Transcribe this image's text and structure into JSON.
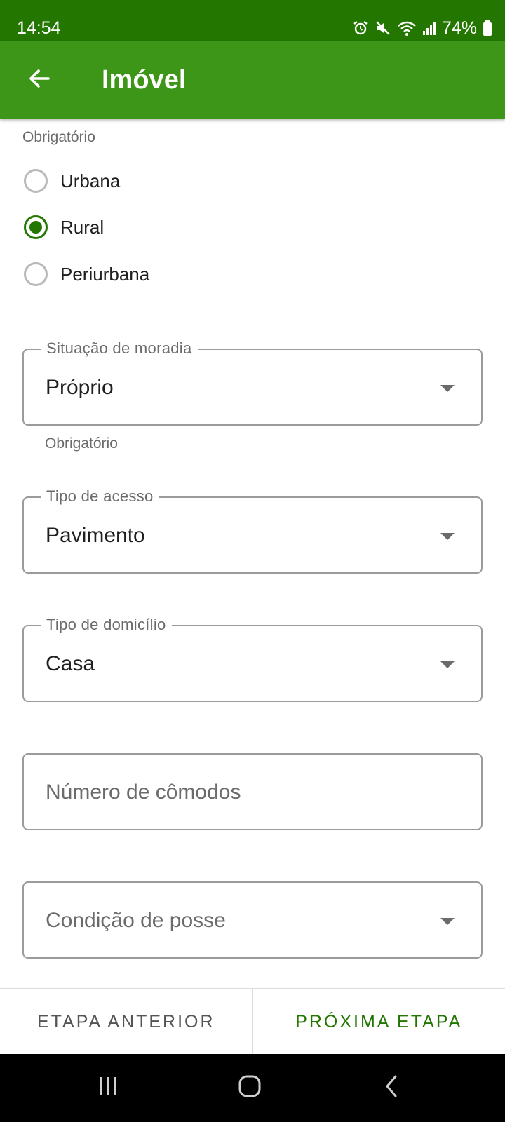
{
  "status_bar": {
    "time": "14:54",
    "battery": "74%",
    "icons": [
      "alarm-icon",
      "mute-icon",
      "wifi-icon",
      "signal-icon",
      "battery-icon"
    ]
  },
  "app_bar": {
    "title": "Imóvel",
    "back_icon": "arrow-left-icon"
  },
  "form": {
    "location_helper": "Obrigatório",
    "location_options": [
      {
        "label": "Urbana",
        "selected": false
      },
      {
        "label": "Rural",
        "selected": true
      },
      {
        "label": "Periurbana",
        "selected": false
      }
    ],
    "situacao": {
      "label": "Situação de moradia",
      "value": "Próprio",
      "helper": "Obrigatório"
    },
    "tipo_acesso": {
      "label": "Tipo de acesso",
      "value": "Pavimento"
    },
    "tipo_domicilio": {
      "label": "Tipo de domicílio",
      "value": "Casa"
    },
    "numero_comodos": {
      "placeholder": "Número de cômodos"
    },
    "condicao_posse": {
      "placeholder": "Condição de posse"
    }
  },
  "footer": {
    "prev_label": "ETAPA ANTERIOR",
    "next_label": "PRÓXIMA ETAPA"
  },
  "nav_bar": {
    "icons": [
      "recent-apps-icon",
      "home-icon",
      "back-nav-icon"
    ]
  },
  "colors": {
    "status_bar": "#237600",
    "app_bar": "#3e9619",
    "accent": "#237600"
  }
}
